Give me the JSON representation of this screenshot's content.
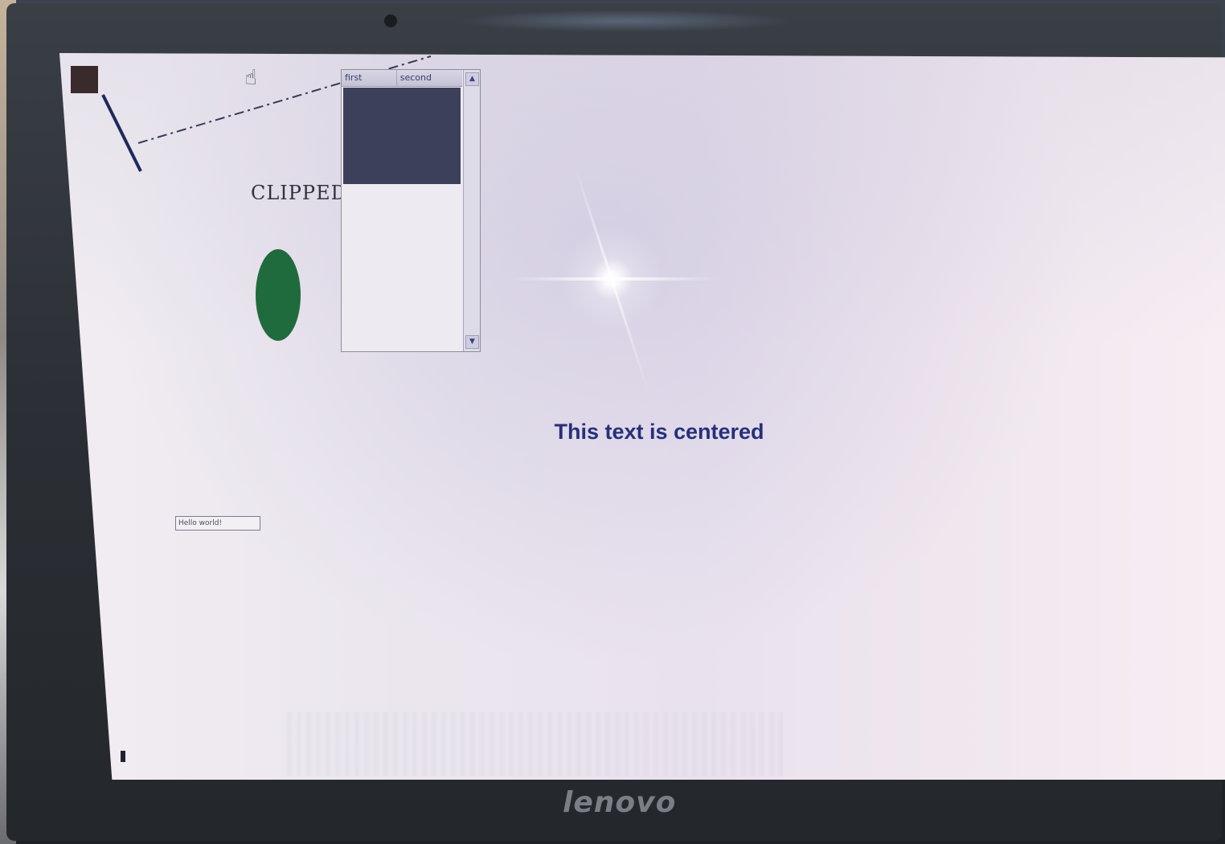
{
  "screen": {
    "listbox": {
      "columns": [
        "first",
        "second"
      ],
      "scroll_up": "▲",
      "scroll_down": "▼"
    },
    "clipped_text": "CLIPPED",
    "centered_text": "This text is centered",
    "text_input": {
      "value": "Hello world!"
    },
    "cursor_icon": "hand-pointer-icon"
  },
  "bezel": {
    "logo": "lenovo"
  },
  "colors": {
    "dark_square": "#3b2a2c",
    "ellipse": "#1f6b3d",
    "centered_text": "#26307a",
    "list_selection": "#3c405a"
  }
}
